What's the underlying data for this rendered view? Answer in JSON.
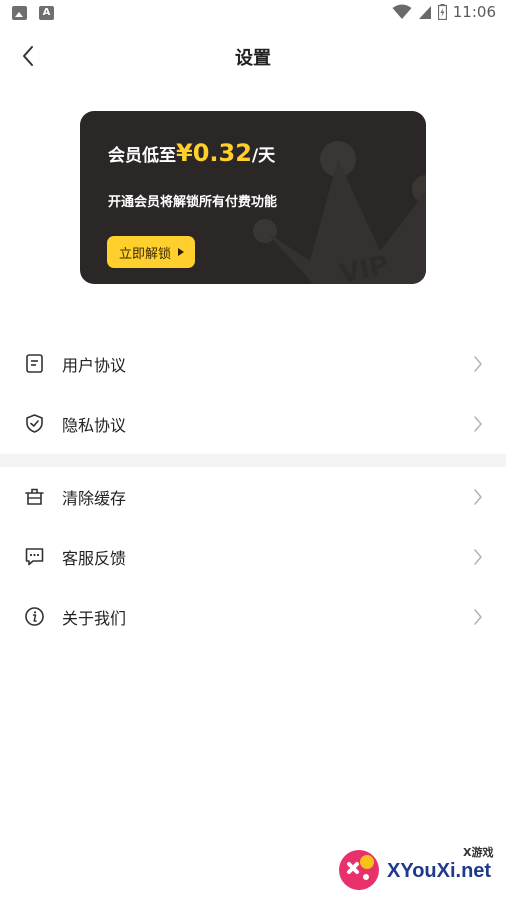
{
  "status_bar": {
    "time": "11:06",
    "icons": [
      "image-icon",
      "a-icon",
      "wifi-icon",
      "signal-icon",
      "battery-icon"
    ]
  },
  "header": {
    "title": "设置"
  },
  "vip_card": {
    "headline_prefix": "会员低至",
    "price": "¥0.32",
    "headline_suffix": "/天",
    "subtitle": "开通会员将解锁所有付费功能",
    "button_label": "立即解锁",
    "watermark_text": "VIP",
    "colors": {
      "background": "#2a2726",
      "accent": "#ffcf2e"
    }
  },
  "menu": {
    "group1": [
      {
        "label": "用户协议",
        "icon": "document-icon"
      },
      {
        "label": "隐私协议",
        "icon": "shield-check-icon"
      }
    ],
    "group2": [
      {
        "label": "清除缓存",
        "icon": "trash-icon"
      },
      {
        "label": "客服反馈",
        "icon": "chat-icon"
      },
      {
        "label": "关于我们",
        "icon": "info-icon"
      }
    ]
  },
  "watermark": {
    "small": "X游戏",
    "main": "XYouXi.net"
  }
}
